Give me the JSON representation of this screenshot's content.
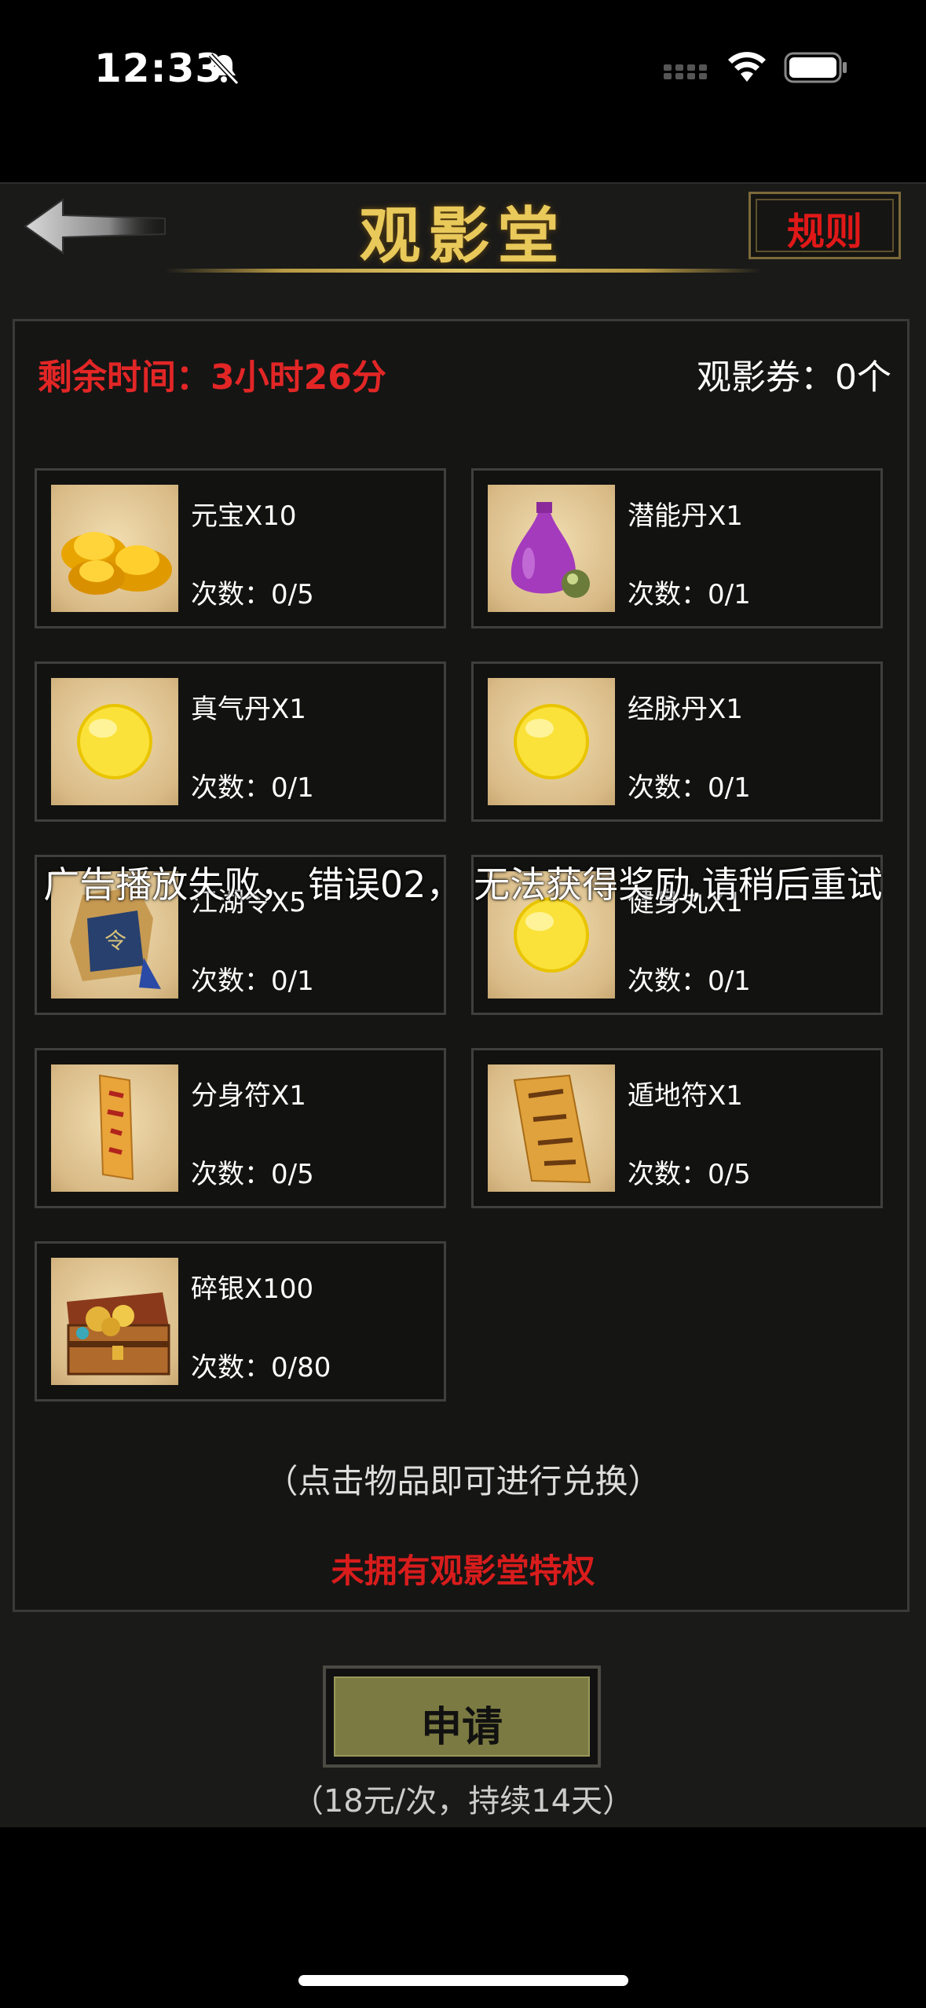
{
  "status_bar": {
    "time": "12:33"
  },
  "header": {
    "title": "观影堂",
    "rules_label": "规则"
  },
  "info": {
    "remaining_time": "剩余时间：3小时26分",
    "tickets": "观影券：0个"
  },
  "items": [
    {
      "name": "元宝X10",
      "count": "次数：0/5",
      "icon": "gold-ingot-icon"
    },
    {
      "name": "潜能丹X1",
      "count": "次数：0/1",
      "icon": "purple-vase-icon"
    },
    {
      "name": "真气丹X1",
      "count": "次数：0/1",
      "icon": "yellow-pill-icon"
    },
    {
      "name": "经脉丹X1",
      "count": "次数：0/1",
      "icon": "yellow-pill-icon"
    },
    {
      "name": "江湖令X5",
      "count": "次数：0/1",
      "icon": "pouch-icon"
    },
    {
      "name": "健身丸X1",
      "count": "次数：0/1",
      "icon": "yellow-pill-icon"
    },
    {
      "name": "分身符X1",
      "count": "次数：0/5",
      "icon": "talisman-icon"
    },
    {
      "name": "遁地符X1",
      "count": "次数：0/5",
      "icon": "talisman-scroll-icon"
    },
    {
      "name": "碎银X100",
      "count": "次数：0/80",
      "icon": "treasure-chest-icon"
    }
  ],
  "hint": "（点击物品即可进行兑换）",
  "no_privilege": "未拥有观影堂特权",
  "apply": {
    "label": "申请",
    "price": "（18元/次，持续14天）"
  },
  "toast": "广告播放失败，  错误02，  无法获得奖励,请稍后重试"
}
